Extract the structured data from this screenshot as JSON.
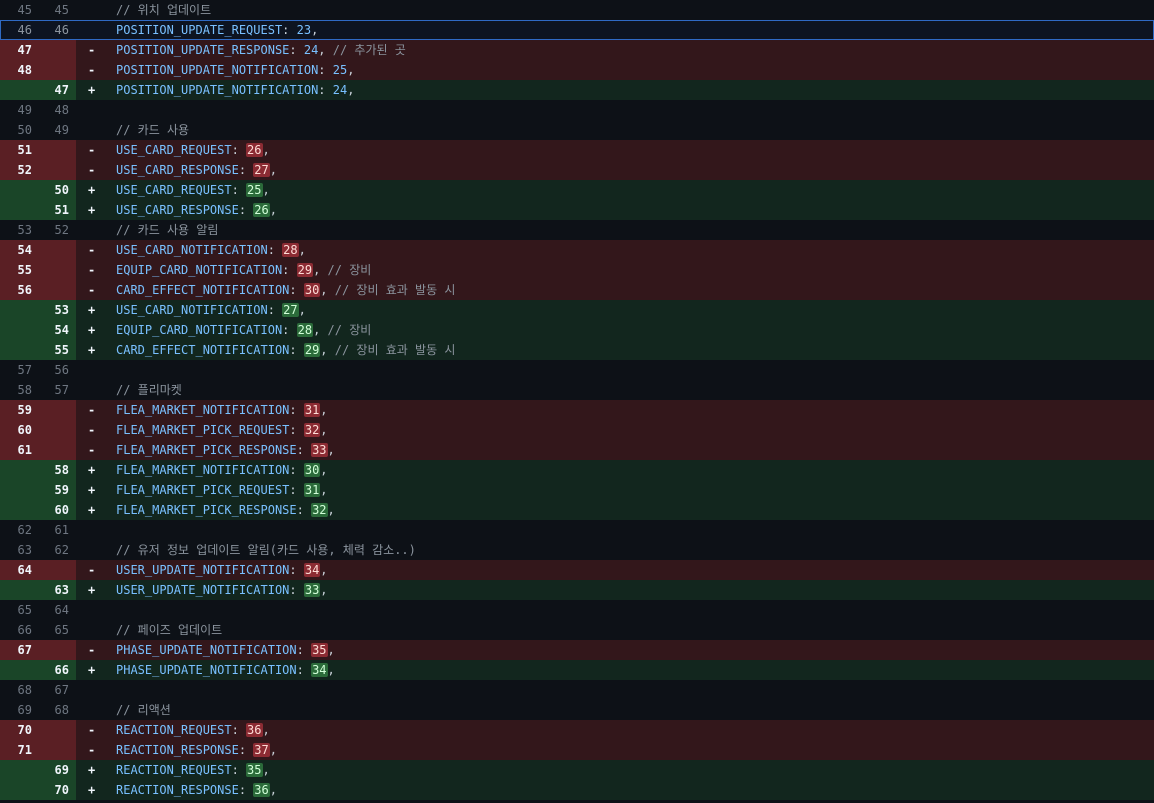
{
  "rows": [
    {
      "type": "ctx",
      "o": "45",
      "n": "45",
      "key": "",
      "val": "",
      "hl": false,
      "cmt": "// 위치 업데이트"
    },
    {
      "type": "ctx",
      "o": "46",
      "n": "46",
      "key": "POSITION_UPDATE_REQUEST",
      "val": "23",
      "hl": false,
      "cmt": "",
      "sel": true
    },
    {
      "type": "del",
      "o": "47",
      "n": "",
      "key": "POSITION_UPDATE_RESPONSE",
      "val": "24",
      "hl": false,
      "cmt": "// 추가된 곳"
    },
    {
      "type": "del",
      "o": "48",
      "n": "",
      "key": "POSITION_UPDATE_NOTIFICATION",
      "val": "25",
      "hl": false,
      "cmt": ""
    },
    {
      "type": "add",
      "o": "",
      "n": "47",
      "key": "POSITION_UPDATE_NOTIFICATION",
      "val": "24",
      "hl": false,
      "cmt": ""
    },
    {
      "type": "ctx",
      "o": "49",
      "n": "48",
      "key": "",
      "val": "",
      "hl": false,
      "cmt": ""
    },
    {
      "type": "ctx",
      "o": "50",
      "n": "49",
      "key": "",
      "val": "",
      "hl": false,
      "cmt": "// 카드 사용"
    },
    {
      "type": "del",
      "o": "51",
      "n": "",
      "key": "USE_CARD_REQUEST",
      "val": "26",
      "hl": true,
      "cmt": ""
    },
    {
      "type": "del",
      "o": "52",
      "n": "",
      "key": "USE_CARD_RESPONSE",
      "val": "27",
      "hl": true,
      "cmt": ""
    },
    {
      "type": "add",
      "o": "",
      "n": "50",
      "key": "USE_CARD_REQUEST",
      "val": "25",
      "hl": true,
      "cmt": ""
    },
    {
      "type": "add",
      "o": "",
      "n": "51",
      "key": "USE_CARD_RESPONSE",
      "val": "26",
      "hl": true,
      "cmt": ""
    },
    {
      "type": "ctx",
      "o": "53",
      "n": "52",
      "key": "",
      "val": "",
      "hl": false,
      "cmt": "// 카드 사용 알림"
    },
    {
      "type": "del",
      "o": "54",
      "n": "",
      "key": "USE_CARD_NOTIFICATION",
      "val": "28",
      "hl": true,
      "cmt": ""
    },
    {
      "type": "del",
      "o": "55",
      "n": "",
      "key": "EQUIP_CARD_NOTIFICATION",
      "val": "29",
      "hl": true,
      "cmt": "// 장비"
    },
    {
      "type": "del",
      "o": "56",
      "n": "",
      "key": "CARD_EFFECT_NOTIFICATION",
      "val": "30",
      "hl": true,
      "cmt": "// 장비 효과 발동 시"
    },
    {
      "type": "add",
      "o": "",
      "n": "53",
      "key": "USE_CARD_NOTIFICATION",
      "val": "27",
      "hl": true,
      "cmt": ""
    },
    {
      "type": "add",
      "o": "",
      "n": "54",
      "key": "EQUIP_CARD_NOTIFICATION",
      "val": "28",
      "hl": true,
      "cmt": "// 장비"
    },
    {
      "type": "add",
      "o": "",
      "n": "55",
      "key": "CARD_EFFECT_NOTIFICATION",
      "val": "29",
      "hl": true,
      "cmt": "// 장비 효과 발동 시"
    },
    {
      "type": "ctx",
      "o": "57",
      "n": "56",
      "key": "",
      "val": "",
      "hl": false,
      "cmt": ""
    },
    {
      "type": "ctx",
      "o": "58",
      "n": "57",
      "key": "",
      "val": "",
      "hl": false,
      "cmt": "// 플리마켓"
    },
    {
      "type": "del",
      "o": "59",
      "n": "",
      "key": "FLEA_MARKET_NOTIFICATION",
      "val": "31",
      "hl": true,
      "cmt": ""
    },
    {
      "type": "del",
      "o": "60",
      "n": "",
      "key": "FLEA_MARKET_PICK_REQUEST",
      "val": "32",
      "hl": true,
      "cmt": ""
    },
    {
      "type": "del",
      "o": "61",
      "n": "",
      "key": "FLEA_MARKET_PICK_RESPONSE",
      "val": "33",
      "hl": true,
      "cmt": ""
    },
    {
      "type": "add",
      "o": "",
      "n": "58",
      "key": "FLEA_MARKET_NOTIFICATION",
      "val": "30",
      "hl": true,
      "cmt": ""
    },
    {
      "type": "add",
      "o": "",
      "n": "59",
      "key": "FLEA_MARKET_PICK_REQUEST",
      "val": "31",
      "hl": true,
      "cmt": ""
    },
    {
      "type": "add",
      "o": "",
      "n": "60",
      "key": "FLEA_MARKET_PICK_RESPONSE",
      "val": "32",
      "hl": true,
      "cmt": ""
    },
    {
      "type": "ctx",
      "o": "62",
      "n": "61",
      "key": "",
      "val": "",
      "hl": false,
      "cmt": ""
    },
    {
      "type": "ctx",
      "o": "63",
      "n": "62",
      "key": "",
      "val": "",
      "hl": false,
      "cmt": "// 유저 정보 업데이트 알림(카드 사용, 체력 감소..)"
    },
    {
      "type": "del",
      "o": "64",
      "n": "",
      "key": "USER_UPDATE_NOTIFICATION",
      "val": "34",
      "hl": true,
      "cmt": ""
    },
    {
      "type": "add",
      "o": "",
      "n": "63",
      "key": "USER_UPDATE_NOTIFICATION",
      "val": "33",
      "hl": true,
      "cmt": ""
    },
    {
      "type": "ctx",
      "o": "65",
      "n": "64",
      "key": "",
      "val": "",
      "hl": false,
      "cmt": ""
    },
    {
      "type": "ctx",
      "o": "66",
      "n": "65",
      "key": "",
      "val": "",
      "hl": false,
      "cmt": "// 페이즈 업데이트"
    },
    {
      "type": "del",
      "o": "67",
      "n": "",
      "key": "PHASE_UPDATE_NOTIFICATION",
      "val": "35",
      "hl": true,
      "cmt": ""
    },
    {
      "type": "add",
      "o": "",
      "n": "66",
      "key": "PHASE_UPDATE_NOTIFICATION",
      "val": "34",
      "hl": true,
      "cmt": ""
    },
    {
      "type": "ctx",
      "o": "68",
      "n": "67",
      "key": "",
      "val": "",
      "hl": false,
      "cmt": ""
    },
    {
      "type": "ctx",
      "o": "69",
      "n": "68",
      "key": "",
      "val": "",
      "hl": false,
      "cmt": "// 리액션"
    },
    {
      "type": "del",
      "o": "70",
      "n": "",
      "key": "REACTION_REQUEST",
      "val": "36",
      "hl": true,
      "cmt": ""
    },
    {
      "type": "del",
      "o": "71",
      "n": "",
      "key": "REACTION_RESPONSE",
      "val": "37",
      "hl": true,
      "cmt": ""
    },
    {
      "type": "add",
      "o": "",
      "n": "69",
      "key": "REACTION_REQUEST",
      "val": "35",
      "hl": true,
      "cmt": ""
    },
    {
      "type": "add",
      "o": "",
      "n": "70",
      "key": "REACTION_RESPONSE",
      "val": "36",
      "hl": true,
      "cmt": ""
    }
  ],
  "signs": {
    "del": "-",
    "add": "+",
    "ctx": ""
  },
  "colors": {
    "del_bg": "#33171b",
    "add_bg": "#12261e",
    "selection_outline": "#2f6ac4"
  }
}
